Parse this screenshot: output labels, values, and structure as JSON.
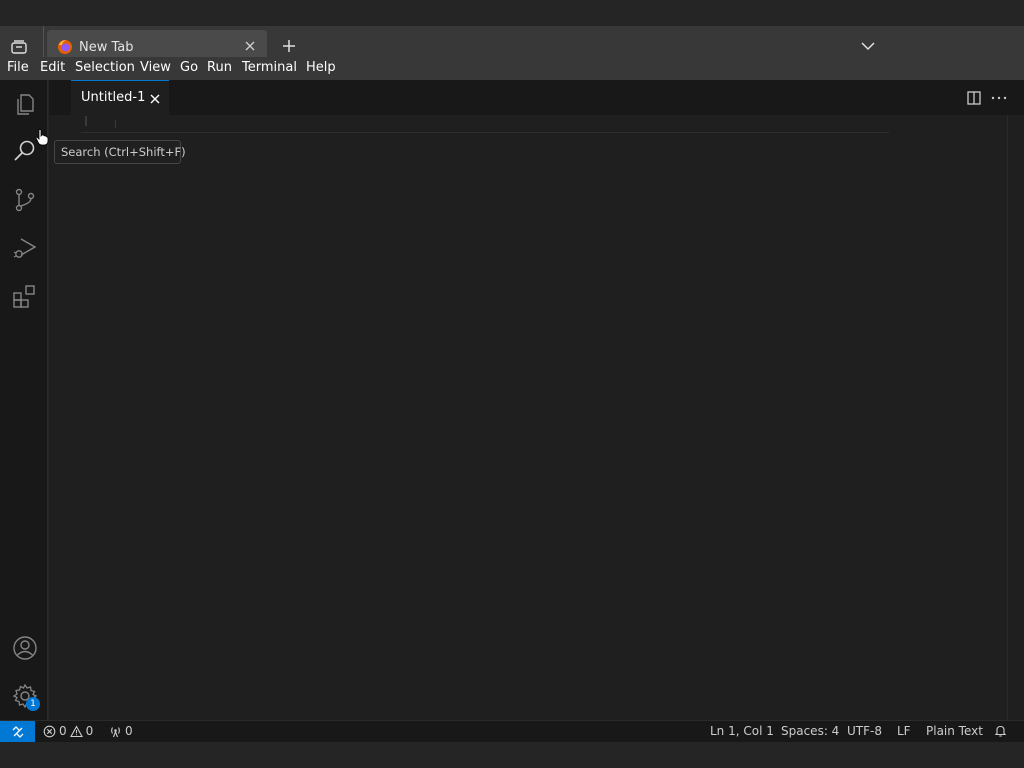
{
  "browser": {
    "tab_title": "New Tab"
  },
  "menubar": {
    "items": [
      "File",
      "Edit",
      "Selection",
      "View",
      "Go",
      "Run",
      "Terminal",
      "Help"
    ]
  },
  "activitybar": {
    "items": [
      "explorer-icon",
      "search-icon",
      "source-control-icon",
      "run-debug-icon",
      "extensions-icon"
    ],
    "bottom_items": [
      "accounts-icon",
      "manage-gear-icon"
    ],
    "manage_badge": "1"
  },
  "tooltip": {
    "text": "Search (Ctrl+Shift+F)"
  },
  "editor": {
    "tab_label": "Untitled-1"
  },
  "statusbar": {
    "errors": "0",
    "warnings": "0",
    "ports": "0",
    "position": "Ln 1, Col 1",
    "spaces": "Spaces: 4",
    "encoding": "UTF-8",
    "eol": "LF",
    "language": "Plain Text"
  },
  "colors": {
    "accent": "#0078d4",
    "editor_bg": "#1f1f1f",
    "sidebar_bg": "#181818",
    "chrome_bg": "#383838"
  }
}
